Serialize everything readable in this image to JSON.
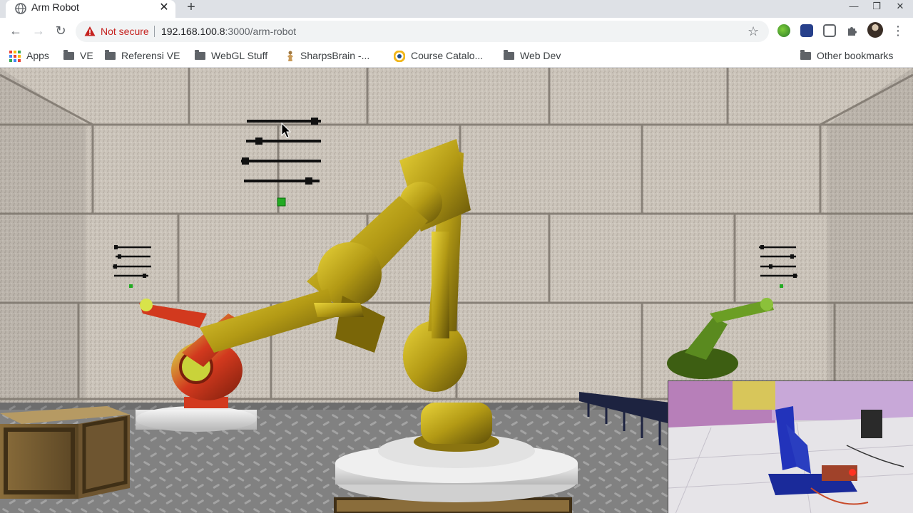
{
  "tab": {
    "title": "Arm Robot",
    "close_glyph": "✕",
    "new_tab_glyph": "+"
  },
  "window_controls": {
    "minimize": "—",
    "restore": "❐",
    "close": "✕"
  },
  "toolbar": {
    "back_glyph": "←",
    "forward_glyph": "→",
    "reload_glyph": "↻",
    "security_label": "Not secure",
    "url_host": "192.168.100.8",
    "url_path": ":3000/arm-robot",
    "star_glyph": "☆",
    "menu_glyph": "⋮"
  },
  "bookmarks": {
    "apps": "Apps",
    "items": [
      "VE",
      "Referensi VE",
      "WebGL Stuff",
      "SharpsBrain -...",
      "Course Catalo...",
      "Web Dev"
    ],
    "other": "Other bookmarks"
  },
  "colors": {
    "warning": "#c5221f",
    "robot_yellow": "#c9b21c",
    "robot_red": "#d2391e",
    "robot_green": "#4f7a1a",
    "indicator_green": "#22aa22",
    "wall": "#c9c2b8",
    "floor": "#7c7c7c"
  },
  "scene": {
    "center_sliders": [
      0.98,
      0.15,
      0.03,
      0.83
    ],
    "left_sliders": [
      0.2,
      0.15,
      0.08,
      0.85
    ],
    "right_sliders": [
      0.1,
      0.9,
      0.3,
      0.95
    ]
  },
  "icons": [
    "globe-icon",
    "close-icon",
    "plus-icon",
    "back-icon",
    "forward-icon",
    "reload-icon",
    "warning-icon",
    "star-icon",
    "puzzle-icon",
    "avatar",
    "menu-icon",
    "folder-icon",
    "apps-icon"
  ]
}
